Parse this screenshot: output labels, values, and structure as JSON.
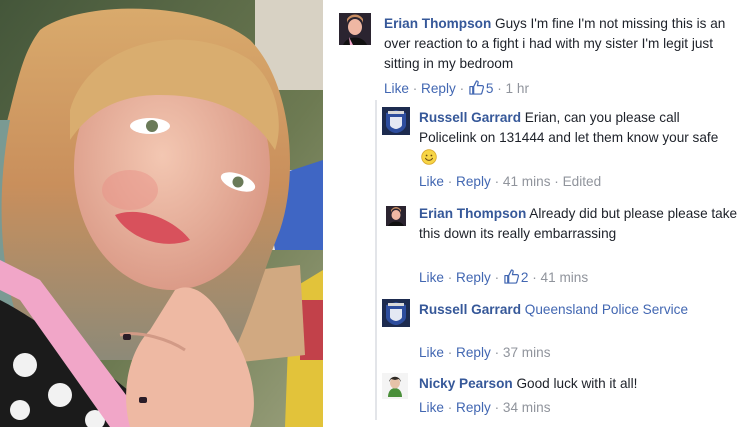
{
  "thread": {
    "main_comment": {
      "author": "Erian Thompson",
      "text": "Guys I'm fine I'm not missing this is an over reaction to a fight i had with my sister I'm legit just sitting in my bedroom",
      "like_label": "Like",
      "reply_label": "Reply",
      "like_count": "5",
      "time": "1 hr"
    },
    "replies": [
      {
        "author": "Russell Garrard",
        "text": "Erian, can you please call Policelink on 131444 and let them know your safe",
        "emoji": "smiling-face-icon",
        "like_label": "Like",
        "reply_label": "Reply",
        "time": "41 mins",
        "edited": "Edited"
      },
      {
        "author": "Erian Thompson",
        "text": "Already did but please please take this down its really embarrassing",
        "like_label": "Like",
        "reply_label": "Reply",
        "like_count": "2",
        "time": "41 mins"
      },
      {
        "author": "Russell Garrard",
        "link_text": "Queensland Police Service",
        "like_label": "Like",
        "reply_label": "Reply",
        "time": "37 mins"
      },
      {
        "author": "Nicky Pearson",
        "text": "Good luck with it all!",
        "like_label": "Like",
        "reply_label": "Reply",
        "time": "34 mins"
      }
    ]
  },
  "colors": {
    "author_link": "#365899",
    "action_link": "#4267b2",
    "meta_text": "#90949c",
    "body_text": "#1d2129"
  }
}
